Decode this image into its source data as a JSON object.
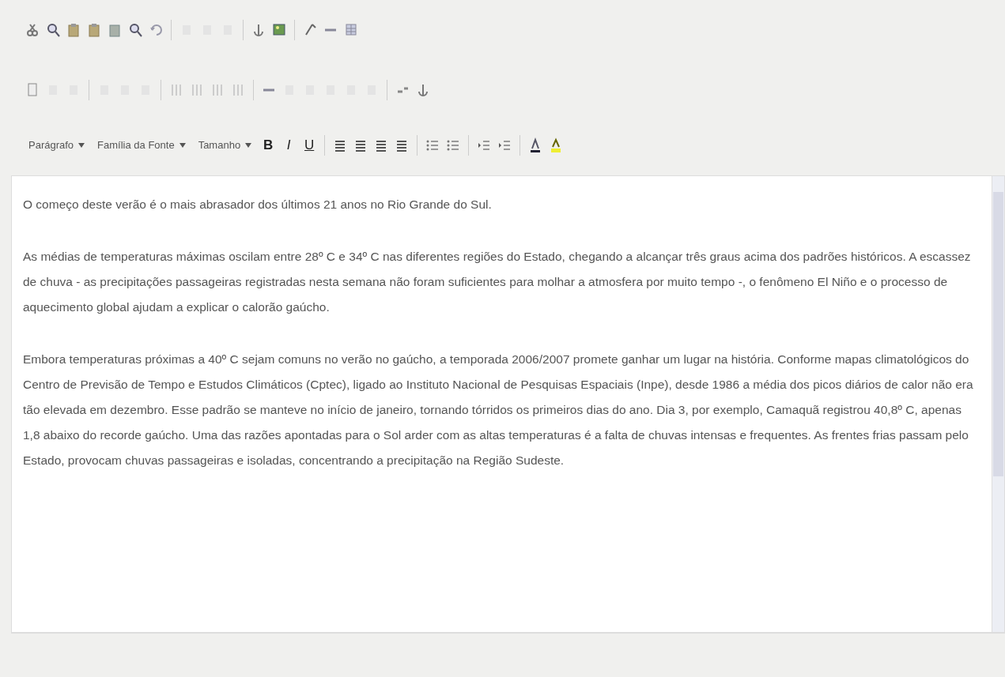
{
  "toolbar": {
    "format_select": "Parágrafo",
    "font_select": "Família da Fonte",
    "size_select": "Tamanho",
    "format_buttons": [
      {
        "label": "B"
      },
      {
        "label": "I"
      },
      {
        "label": "U"
      }
    ]
  },
  "content": {
    "paragraphs": [
      "O começo deste verão é o mais abrasador dos últimos 21 anos no Rio Grande do Sul.",
      "As médias de temperaturas máximas oscilam entre 28º C e 34º C nas diferentes regiões do Estado, chegando a alcançar três graus acima dos padrões históricos. A escassez de chuva - as precipitações passageiras registradas nesta semana não foram suficientes para molhar a atmosfera por muito tempo -, o fenômeno El Niño e o processo de aquecimento global ajudam a explicar o calorão gaúcho.",
      "Embora temperaturas próximas a 40º C sejam comuns no verão no gaúcho, a temporada 2006/2007 promete ganhar um lugar na história. Conforme mapas climatológicos do Centro de Previsão de Tempo e Estudos Climáticos (Cptec), ligado ao Instituto Nacional de Pesquisas Espaciais (Inpe), desde 1986 a média dos picos diários de calor não era tão elevada em dezembro. Esse padrão se manteve no início de janeiro, tornando tórridos os primeiros dias do ano. Dia 3, por exemplo, Camaquã registrou 40,8º C, apenas 1,8 abaixo do recorde gaúcho. Uma das razões apontadas para o Sol arder com as altas temperaturas é a falta de chuvas intensas e frequentes. As frentes frias passam pelo Estado, provocam chuvas passageiras e isoladas, concentrando a precipitação na Região Sudeste."
    ]
  }
}
